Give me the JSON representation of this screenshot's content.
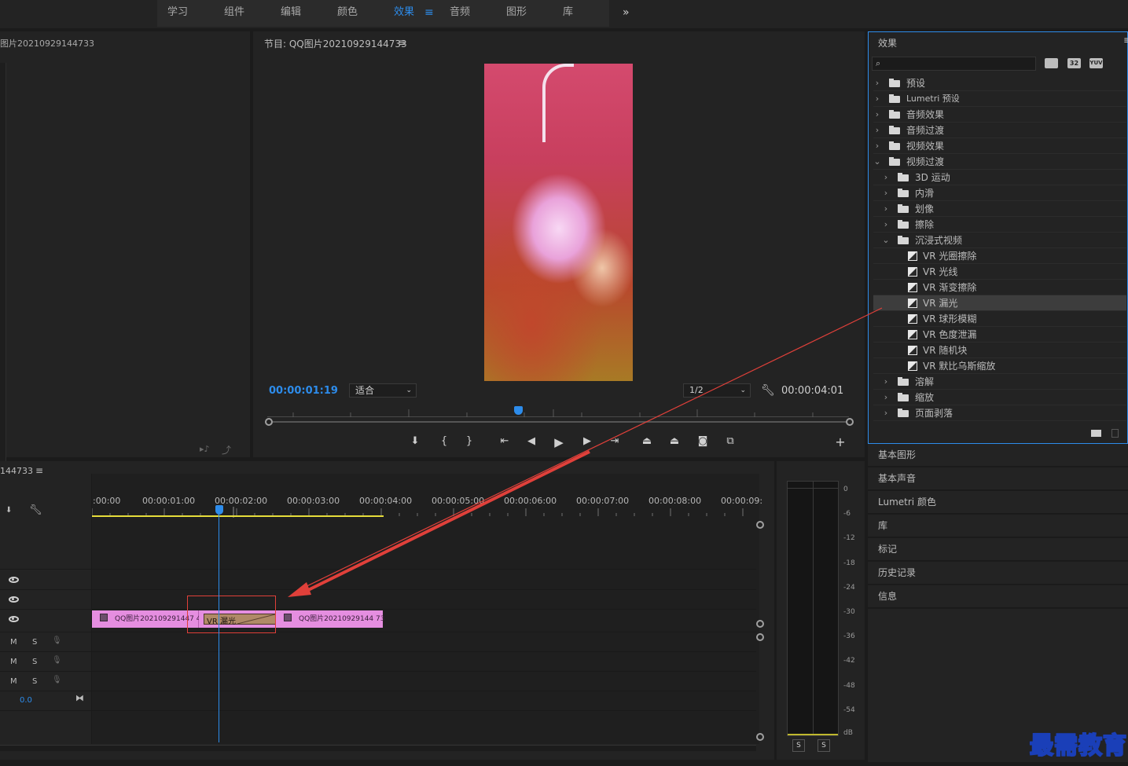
{
  "workspaces": [
    {
      "label": "学习",
      "active": false
    },
    {
      "label": "组件",
      "active": false
    },
    {
      "label": "编辑",
      "active": false
    },
    {
      "label": "颜色",
      "active": false
    },
    {
      "label": "效果",
      "active": true
    },
    {
      "label": "音频",
      "active": false
    },
    {
      "label": "图形",
      "active": false
    },
    {
      "label": "库",
      "active": false
    }
  ],
  "source_panel": {
    "title": "图片20210929144733"
  },
  "program": {
    "title": "节目: QQ图片20210929144733",
    "current_time": "00:00:01:19",
    "fit": "适合",
    "resolution": "1/2",
    "duration": "00:00:04:01"
  },
  "effects": {
    "title": "效果",
    "search_placeholder": "",
    "badges": [
      "32",
      "YUV"
    ],
    "tree": [
      {
        "label": "预设"
      },
      {
        "label": "Lumetri 预设"
      },
      {
        "label": "音频效果"
      },
      {
        "label": "音频过渡"
      },
      {
        "label": "视频效果"
      },
      {
        "label": "视频过渡"
      },
      {
        "label": "3D 运动"
      },
      {
        "label": "内滑"
      },
      {
        "label": "划像"
      },
      {
        "label": "擦除"
      },
      {
        "label": "沉浸式视频"
      },
      {
        "label": "VR 光圈擦除"
      },
      {
        "label": "VR 光线"
      },
      {
        "label": "VR 渐变擦除"
      },
      {
        "label": "VR 漏光"
      },
      {
        "label": "VR 球形模糊"
      },
      {
        "label": "VR 色度泄漏"
      },
      {
        "label": "VR 随机块"
      },
      {
        "label": "VR 默比乌斯缩放"
      },
      {
        "label": "溶解"
      },
      {
        "label": "缩放"
      },
      {
        "label": "页面剥落"
      }
    ]
  },
  "side_panels": [
    "基本图形",
    "基本声音",
    "Lumetri 颜色",
    "库",
    "标记",
    "历史记录",
    "信息"
  ],
  "timeline": {
    "title": "144733",
    "ruler": [
      ":00:00",
      "00:00:01:00",
      "00:00:02:00",
      "00:00:03:00",
      "00:00:04:00",
      "00:00:05:00",
      "00:00:06:00",
      "00:00:07:00",
      "00:00:08:00",
      "00:00:09:"
    ],
    "clip1_label": "QQ图片202109291447 41.",
    "clip2_label": "QQ图片20210929144 73",
    "transition_label": "VR 漏光",
    "audio_tracks": [
      {
        "m": "M",
        "s": "S"
      },
      {
        "m": "M",
        "s": "S"
      },
      {
        "m": "M",
        "s": "S"
      }
    ],
    "master_value": "0.0"
  },
  "meter": {
    "db_labels": [
      "0",
      "-6",
      "-12",
      "-18",
      "-24",
      "-30",
      "-36",
      "-42",
      "-48",
      "-54",
      "dB"
    ],
    "solo": [
      "S",
      "S"
    ]
  },
  "watermark": "最需教育",
  "colors": {
    "accent": "#2d8ceb",
    "clip": "#e58ee0",
    "transition": "#b08a67",
    "highlight": "#e0403a"
  }
}
